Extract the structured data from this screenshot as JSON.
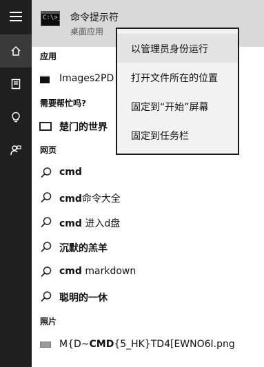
{
  "rail": {
    "items": [
      {
        "icon": "hamburger-menu-icon"
      },
      {
        "icon": "home-icon"
      },
      {
        "icon": "notebook-icon"
      },
      {
        "icon": "lightbulb-icon"
      },
      {
        "icon": "feedback-icon"
      }
    ]
  },
  "best_match": {
    "title": "命令提示符",
    "subtitle": "桌面应用",
    "icon": "cmd-icon",
    "icon_text": "C:\\>_"
  },
  "sections": {
    "apps": "应用",
    "help": "需要帮忙吗?",
    "web": "网页",
    "photos": "照片"
  },
  "apps": [
    {
      "label": "Images2PD",
      "icon": "cmd-icon"
    }
  ],
  "help": [
    {
      "label": "楚门的世界",
      "icon": "book-icon"
    }
  ],
  "web": [
    {
      "bold": "cmd",
      "rest": ""
    },
    {
      "bold": "cmd",
      "rest": "命令大全"
    },
    {
      "bold": "cmd",
      "rest": " 进入d盘"
    },
    {
      "bold": "沉默的羔羊",
      "rest": ""
    },
    {
      "bold": "cmd",
      "rest": " markdown"
    },
    {
      "bold": "聪明的一休",
      "rest": ""
    }
  ],
  "photos": [
    {
      "pre": "M{D~",
      "bold": "CMD",
      "post": "{5_HK}TD4[EWNO6I.png",
      "icon": "image-icon"
    }
  ],
  "context_menu": [
    {
      "label": "以管理员身份运行"
    },
    {
      "label": "打开文件所在的位置"
    },
    {
      "label": "固定到“开始”屏幕"
    },
    {
      "label": "固定到任务栏"
    }
  ],
  "colors": {
    "rail_bg": "#1f1f1f",
    "rail_active": "#3a3a3a",
    "best_match_bg": "#d9d9d9",
    "menu_bg": "#f2f2f2"
  }
}
